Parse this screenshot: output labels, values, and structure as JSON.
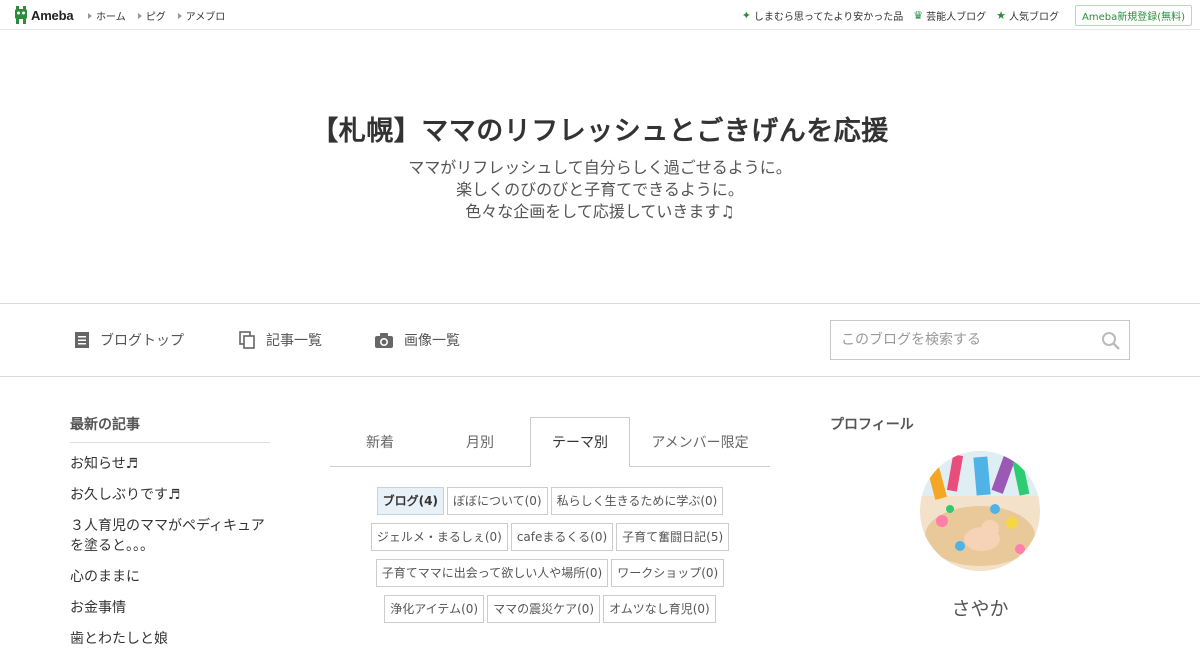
{
  "topbar": {
    "logo_text": "Ameba",
    "nav": [
      {
        "label": "ホーム"
      },
      {
        "label": "ピグ"
      },
      {
        "label": "アメブロ"
      }
    ],
    "right_links": [
      {
        "label": "しまむら思ってたより安かった品",
        "icon": "sparkle-icon"
      },
      {
        "label": "芸能人ブログ",
        "icon": "crown-icon"
      },
      {
        "label": "人気ブログ",
        "icon": "star-icon"
      }
    ],
    "register_label": "Ameba新規登録(無料)"
  },
  "header": {
    "title": "【札幌】ママのリフレッシュとごきげんを応援",
    "description_lines": [
      "ママがリフレッシュして自分らしく過ごせるように。",
      "楽しくのびのびと子育てできるように。",
      "色々な企画をして応援していきます♫"
    ]
  },
  "nav": {
    "items": [
      {
        "label": "ブログトップ",
        "icon": "document-icon"
      },
      {
        "label": "記事一覧",
        "icon": "copy-icon"
      },
      {
        "label": "画像一覧",
        "icon": "camera-icon"
      }
    ],
    "search_placeholder": "このブログを検索する"
  },
  "latest": {
    "title": "最新の記事",
    "items": [
      "お知らせ♬",
      "お久しぶりです♬",
      "３人育児のママがペディキュアを塗ると。。。",
      "心のままに",
      "お金事情",
      "歯とわたしと娘"
    ]
  },
  "tabs": [
    {
      "label": "新着"
    },
    {
      "label": "月別"
    },
    {
      "label": "テーマ別"
    },
    {
      "label": "アメンバー限定"
    }
  ],
  "themes": [
    [
      "ブログ(4)",
      "ぼぼについて(0)",
      "私らしく生きるために学ぶ(0)"
    ],
    [
      "ジェルメ・まるしぇ(0)",
      "cafeまるくる(0)",
      "子育て奮闘日記(5)"
    ],
    [
      "子育てママに出会って欲しい人や場所(0)",
      "ワークショップ(0)"
    ],
    [
      "浄化アイテム(0)",
      "ママの震災ケア(0)",
      "オムツなし育児(0)"
    ]
  ],
  "profile": {
    "title": "プロフィール",
    "nickname": "さやか"
  },
  "colors": {
    "accent_green": "#2d8c3c",
    "active_theme_bg": "#e8f0f8"
  }
}
